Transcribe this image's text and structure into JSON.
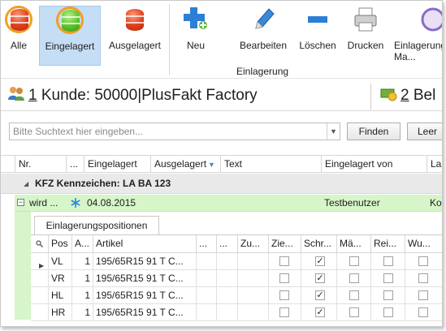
{
  "ribbon": {
    "buttons": [
      {
        "label": "Alle"
      },
      {
        "label": "Eingelagert"
      },
      {
        "label": "Ausgelagert"
      },
      {
        "label": "Neu"
      },
      {
        "label": "Bearbeiten"
      },
      {
        "label": "Löschen"
      },
      {
        "label": "Drucken"
      },
      {
        "label": "Einlagerungs Ma..."
      }
    ],
    "group_label": "Einlagerung"
  },
  "customers": {
    "tab1": {
      "num": "1",
      "text": " Kunde: 50000|PlusFakt Factory"
    },
    "tab2": {
      "num": "2",
      "text": " Bel"
    }
  },
  "search": {
    "placeholder": "Bitte Suchtext hier eingeben...",
    "find": "Finden",
    "clear": "Leer"
  },
  "grid": {
    "columns": [
      "Nr.",
      "...",
      "Eingelagert",
      "Ausgelagert",
      "Text",
      "Eingelagert von",
      "La"
    ],
    "group": "KFZ Kennzeichen: LA BA 123",
    "row": {
      "nr": "wird ...",
      "eingelagert": "04.08.2015",
      "von": "Testbenutzer",
      "la": "Ko"
    }
  },
  "detail": {
    "tab": "Einlagerungspositionen",
    "columns": [
      "Pos",
      "A...",
      "Artikel",
      "...",
      "...",
      "Zu...",
      "Zie...",
      "Schr...",
      "Mä...",
      "Rei...",
      "Wu..."
    ],
    "rows": [
      {
        "pos": "VL",
        "anz": "1",
        "artikel": "195/65R15 91 T C...",
        "schr": true
      },
      {
        "pos": "VR",
        "anz": "1",
        "artikel": "195/65R15 91 T C...",
        "schr": true
      },
      {
        "pos": "HL",
        "anz": "1",
        "artikel": "195/65R15 91 T C...",
        "schr": true
      },
      {
        "pos": "HR",
        "anz": "1",
        "artikel": "195/65R15 91 T C...",
        "schr": true
      }
    ]
  }
}
